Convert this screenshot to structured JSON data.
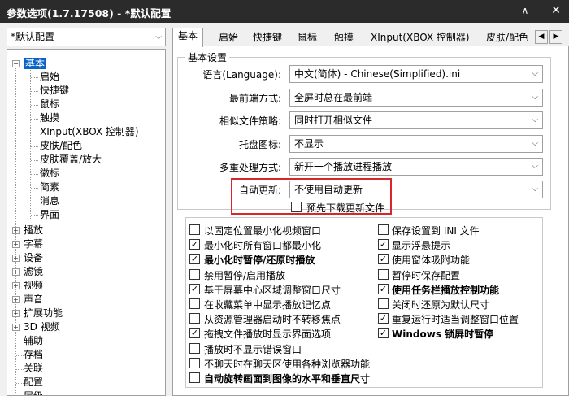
{
  "window": {
    "title": "参数选项(1.7.17508) - *默认配置"
  },
  "profile": {
    "value": "*默认配置"
  },
  "tree": {
    "items": [
      {
        "label": "基本",
        "selected": true
      },
      {
        "label": "启始"
      },
      {
        "label": "快捷键"
      },
      {
        "label": "鼠标"
      },
      {
        "label": "触摸"
      },
      {
        "label": "XInput(XBOX 控制器)"
      },
      {
        "label": "皮肤/配色"
      },
      {
        "label": "皮肤覆盖/放大"
      },
      {
        "label": "徽标"
      },
      {
        "label": "简素"
      },
      {
        "label": "消息"
      },
      {
        "label": "界面"
      },
      {
        "label": "播放"
      },
      {
        "label": "字幕"
      },
      {
        "label": "设备"
      },
      {
        "label": "滤镜"
      },
      {
        "label": "视频"
      },
      {
        "label": "声音"
      },
      {
        "label": "扩展功能"
      },
      {
        "label": "3D 视频"
      },
      {
        "label": "辅助"
      },
      {
        "label": "存档"
      },
      {
        "label": "关联"
      },
      {
        "label": "配置"
      },
      {
        "label": "层级"
      }
    ]
  },
  "tabs": [
    "基本",
    "启始",
    "快捷键",
    "鼠标",
    "触摸",
    "XInput(XBOX 控制器)",
    "皮肤/配色"
  ],
  "basic": {
    "group_title": "基本设置",
    "rows": [
      {
        "label": "语言(Language):",
        "value": "中文(简体) - Chinese(Simplified).ini"
      },
      {
        "label": "最前端方式:",
        "value": "全屏时总在最前端"
      },
      {
        "label": "相似文件策略:",
        "value": "同时打开相似文件"
      },
      {
        "label": "托盘图标:",
        "value": "不显示"
      },
      {
        "label": "多重处理方式:",
        "value": "新开一个播放进程播放"
      },
      {
        "label": "自动更新:",
        "value": "不使用自动更新"
      }
    ],
    "predownload": "预先下载更新文件"
  },
  "options_left": [
    {
      "label": "以固定位置最小化视频窗口",
      "checked": false,
      "bold": false
    },
    {
      "label": "最小化时所有窗口都最小化",
      "checked": true,
      "bold": false
    },
    {
      "label": "最小化时暂停/还原时播放",
      "checked": true,
      "bold": true
    },
    {
      "label": "禁用暂停/启用播放",
      "checked": false,
      "bold": false
    },
    {
      "label": "基于屏幕中心区域调整窗口尺寸",
      "checked": true,
      "bold": false
    },
    {
      "label": "在收藏菜单中显示播放记忆点",
      "checked": false,
      "bold": false
    },
    {
      "label": "从资源管理器启动时不转移焦点",
      "checked": false,
      "bold": false
    },
    {
      "label": "拖拽文件播放时显示界面选项",
      "checked": true,
      "bold": false
    },
    {
      "label": "播放时不显示错误窗口",
      "checked": false,
      "bold": false
    },
    {
      "label": "不聊天时在聊天区使用各种浏览器功能",
      "checked": false,
      "bold": false
    },
    {
      "label": "自动旋转画面到图像的水平和垂直尺寸",
      "checked": false,
      "bold": true
    }
  ],
  "options_right": [
    {
      "label": "保存设置到 INI 文件",
      "checked": false,
      "bold": false
    },
    {
      "label": "显示浮悬提示",
      "checked": true,
      "bold": false
    },
    {
      "label": "使用窗体吸附功能",
      "checked": true,
      "bold": false
    },
    {
      "label": "暂停时保存配置",
      "checked": false,
      "bold": false
    },
    {
      "label": "使用任务栏播放控制功能",
      "checked": true,
      "bold": true
    },
    {
      "label": "关闭时还原为默认尺寸",
      "checked": false,
      "bold": false
    },
    {
      "label": "重复运行时适当调整窗口位置",
      "checked": true,
      "bold": false
    },
    {
      "label": "Windows 锁屏时暂停",
      "checked": true,
      "bold": true
    }
  ]
}
